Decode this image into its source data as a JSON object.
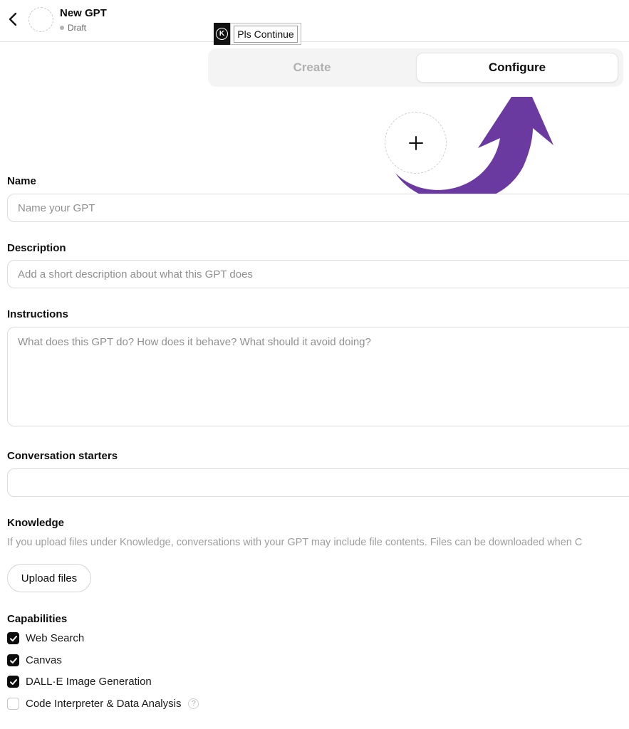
{
  "header": {
    "title": "New GPT",
    "status": "Draft"
  },
  "overlay": {
    "logo_letter": "K",
    "button_label": "Pls Continue"
  },
  "tabs": [
    {
      "label": "Create",
      "active": false
    },
    {
      "label": "Configure",
      "active": true
    }
  ],
  "form": {
    "name": {
      "label": "Name",
      "placeholder": "Name your GPT",
      "value": ""
    },
    "description": {
      "label": "Description",
      "placeholder": "Add a short description about what this GPT does",
      "value": ""
    },
    "instructions": {
      "label": "Instructions",
      "placeholder": "What does this GPT do? How does it behave? What should it avoid doing?",
      "value": ""
    },
    "conversation_starters": {
      "label": "Conversation starters",
      "value": ""
    },
    "knowledge": {
      "label": "Knowledge",
      "hint": "If you upload files under Knowledge, conversations with your GPT may include file contents. Files can be downloaded when C",
      "upload_label": "Upload files"
    },
    "capabilities": {
      "label": "Capabilities",
      "items": [
        {
          "label": "Web Search",
          "checked": true
        },
        {
          "label": "Canvas",
          "checked": true
        },
        {
          "label": "DALL·E Image Generation",
          "checked": true
        },
        {
          "label": "Code Interpreter & Data Analysis",
          "checked": false,
          "help_icon": "?"
        }
      ]
    }
  },
  "colors": {
    "arrow": "#6b3aa0",
    "checkbox_on": "#0d0d0d",
    "placeholder": "#8f8f8f"
  },
  "icons": [
    "chevron-left-icon",
    "plus-icon",
    "check-icon",
    "help-circle-icon"
  ]
}
